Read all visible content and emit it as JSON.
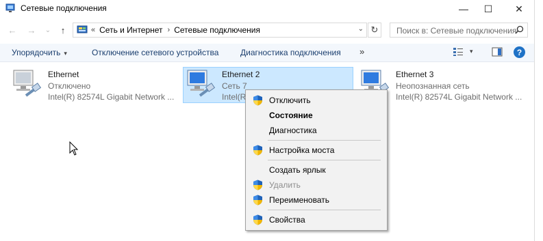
{
  "window": {
    "title": "Сетевые подключения",
    "minimize_glyph": "—",
    "maximize_glyph": "☐",
    "close_glyph": "✕"
  },
  "nav": {
    "back_glyph": "←",
    "forward_glyph": "→",
    "recent_glyph": "⌄",
    "up_glyph": "↑"
  },
  "address": {
    "overflow": "«",
    "crumbs": [
      "Сеть и Интернет",
      "Сетевые подключения"
    ],
    "separator": "›",
    "dropdown_glyph": "⌄",
    "refresh_glyph": "↻"
  },
  "search": {
    "placeholder": "Поиск в: Сетевые подключения"
  },
  "toolbar": {
    "organize": "Упорядочить",
    "disable_device": "Отключение сетевого устройства",
    "diagnose": "Диагностика подключения",
    "more": "»",
    "dropdown_glyph": "▾",
    "help_glyph": "?"
  },
  "connections": [
    {
      "name": "Ethernet",
      "status": "Отключено",
      "adapter": "Intel(R) 82574L Gigabit Network ..."
    },
    {
      "name": "Ethernet 2",
      "status": "Сеть 7",
      "adapter": "Intel(R) 82574L Gigabit Network ..."
    },
    {
      "name": "Ethernet 3",
      "status": "Неопознанная сеть",
      "adapter": "Intel(R) 82574L Gigabit Network ..."
    }
  ],
  "context_menu": {
    "disable": "Отключить",
    "status": "Состояние",
    "diagnostics": "Диагностика",
    "bridge": "Настройка моста",
    "shortcut": "Создать ярлык",
    "delete": "Удалить",
    "rename": "Переименовать",
    "properties": "Свойства"
  },
  "colors": {
    "selection": "#cce8ff",
    "selection_border": "#99d1ff",
    "accent": "#0063b1"
  }
}
